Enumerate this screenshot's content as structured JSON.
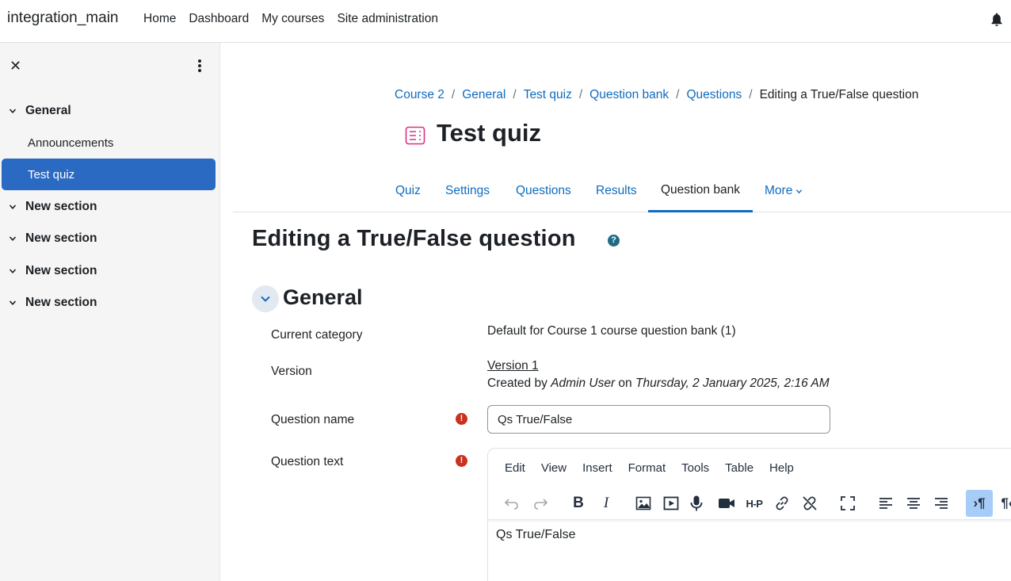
{
  "navbar": {
    "brand": "integration_main",
    "links": [
      "Home",
      "Dashboard",
      "My courses",
      "Site administration"
    ]
  },
  "sidebar": {
    "sections": [
      {
        "label": "General",
        "items": [
          "Announcements",
          "Test quiz"
        ],
        "active_item": "Test quiz"
      },
      {
        "label": "New section"
      },
      {
        "label": "New section"
      },
      {
        "label": "New section"
      },
      {
        "label": "New section"
      }
    ]
  },
  "breadcrumb": {
    "links": [
      "Course 2",
      "General",
      "Test quiz",
      "Question bank",
      "Questions"
    ],
    "current": "Editing a True/False question"
  },
  "page": {
    "title": "Test quiz",
    "icon": "quiz-icon",
    "accent_color": "#d63384"
  },
  "tabs": {
    "items": [
      "Quiz",
      "Settings",
      "Questions",
      "Results",
      "Question bank",
      "More"
    ],
    "active": "Question bank"
  },
  "heading": "Editing a True/False question",
  "section": {
    "title": "General",
    "fields": {
      "category_label": "Current category",
      "category_value": "Default for Course 1 course question bank (1)",
      "version_label": "Version",
      "version_link": "Version 1",
      "created_prefix": "Created by",
      "created_user": "Admin User",
      "created_on": "on",
      "created_date": "Thursday, 2 January 2025, 2:16 AM",
      "name_label": "Question name",
      "name_value": "Qs True/False",
      "text_label": "Question text"
    }
  },
  "editor": {
    "menus": [
      "Edit",
      "View",
      "Insert",
      "Format",
      "Tools",
      "Table",
      "Help"
    ],
    "content": "Qs True/False"
  },
  "colors": {
    "link": "#0f6cbf",
    "active_nav": "#2b6ac2",
    "required": "#ca3120",
    "help": "#1d6c84"
  }
}
